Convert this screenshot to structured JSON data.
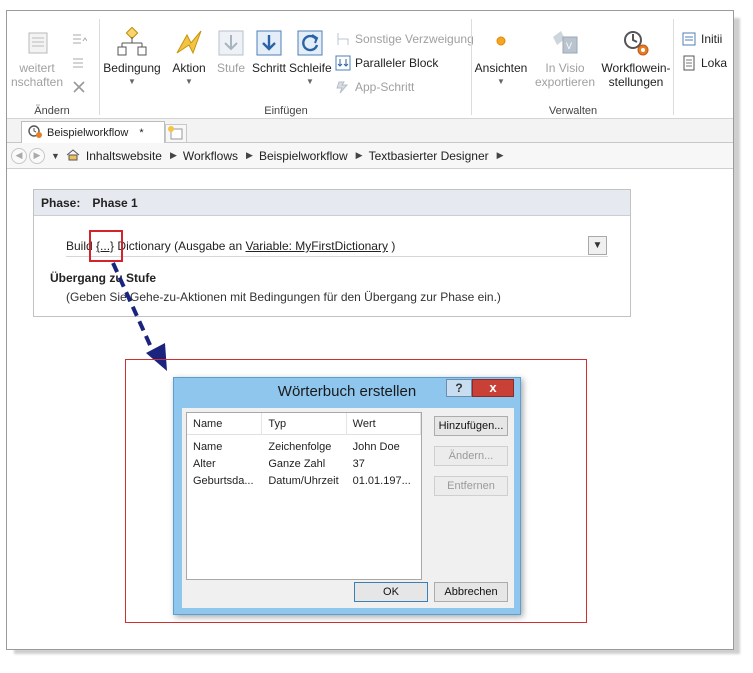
{
  "ribbon": {
    "groups": {
      "aendern": {
        "label": "Ändern",
        "items": [
          "weitert",
          "nschaften"
        ]
      },
      "einfuegen": {
        "label": "Einfügen",
        "big_buttons": [
          "Bedingung",
          "Aktion",
          "Stufe",
          "Schritt",
          "Schleife"
        ],
        "small_buttons": [
          "Sonstige Verzweigung",
          "Paralleler Block",
          "App-Schritt"
        ]
      },
      "verwalten": {
        "label": "Verwalten",
        "big_buttons": [
          "Ansichten",
          "In Visio exportieren",
          "Workflowein- stellungen"
        ],
        "visio_line1": "In Visio",
        "visio_line2": "exportieren",
        "settings_line1": "Workflowein-",
        "settings_line2": "stellungen"
      },
      "partial": {
        "items": [
          "Initii",
          "Loka"
        ]
      }
    }
  },
  "tab": {
    "label": "Beispielworkflow",
    "modified_marker": "*"
  },
  "breadcrumb": [
    "Inhaltswebsite",
    "Workflows",
    "Beispielworkflow",
    "Textbasierter Designer"
  ],
  "phase": {
    "label": "Phase:",
    "name": "Phase 1",
    "action_prefix": "Build",
    "action_param": "{...}",
    "action_mid": "Dictionary (Ausgabe an",
    "action_variable": "Variable: MyFirstDictionary",
    "action_suffix": ")",
    "transition_title": "Übergang zu Stufe",
    "transition_hint": "(Geben Sie Gehe-zu-Aktionen mit Bedingungen für den Übergang zur Phase ein.)"
  },
  "dialog": {
    "title": "Wörterbuch erstellen",
    "help": "?",
    "close": "x",
    "columns": [
      "Name",
      "Typ",
      "Wert"
    ],
    "rows": [
      [
        "Name",
        "Zeichenfolge",
        "John Doe"
      ],
      [
        "Alter",
        "Ganze Zahl",
        "37"
      ],
      [
        "Geburtsda...",
        "Datum/Uhrzeit",
        "01.01.197..."
      ]
    ],
    "buttons": {
      "add": "Hinzufügen...",
      "edit": "Ändern...",
      "remove": "Entfernen",
      "ok": "OK",
      "cancel": "Abbrechen"
    }
  },
  "colors": {
    "dialog_frame": "#8fc6ee",
    "highlight_red": "#d4242b",
    "arrow": "#1a237e"
  }
}
